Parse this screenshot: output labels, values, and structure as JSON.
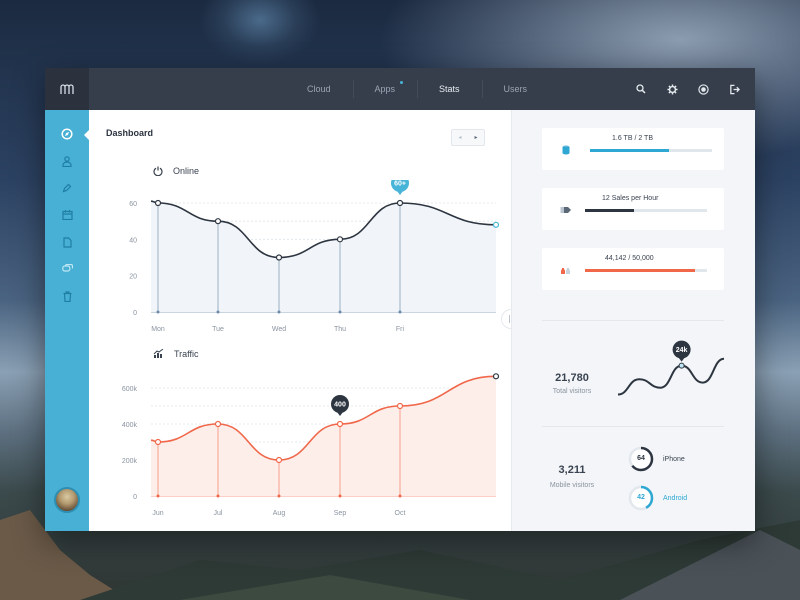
{
  "topbar": {
    "logo_icon": "m-logo-icon",
    "nav": [
      {
        "label": "Cloud",
        "active": false,
        "badge": false
      },
      {
        "label": "Apps",
        "active": false,
        "badge": true
      },
      {
        "label": "Stats",
        "active": true,
        "badge": false
      },
      {
        "label": "Users",
        "active": false,
        "badge": false
      }
    ],
    "tools": [
      "search-icon",
      "gear-icon",
      "globe-icon",
      "logout-icon"
    ]
  },
  "sidebar": {
    "items": [
      {
        "icon": "compass-icon",
        "active": true
      },
      {
        "icon": "user-icon",
        "active": false
      },
      {
        "icon": "pen-icon",
        "active": false
      },
      {
        "icon": "calendar-icon",
        "active": false
      },
      {
        "icon": "file-icon",
        "active": false
      },
      {
        "icon": "chat-icon",
        "active": false
      },
      {
        "icon": "trash-icon",
        "active": false
      }
    ],
    "avatar": "user-avatar"
  },
  "main": {
    "title": "Dashboard",
    "pager": {
      "prev": "◂",
      "next": "▸"
    }
  },
  "chart_data": [
    {
      "type": "line",
      "title": "Online",
      "icon": "power-icon",
      "categories": [
        "Mon",
        "Tue",
        "Wed",
        "Thu",
        "Fri"
      ],
      "values": [
        60,
        50,
        30,
        40,
        60
      ],
      "trailing_value": 48,
      "leading_value": 61,
      "ylim": [
        0,
        60
      ],
      "yticks": [
        "0",
        "20",
        "40",
        "60"
      ],
      "grid": true,
      "highlight": {
        "index": 4,
        "label": "60+"
      },
      "line_color": "#2d3541",
      "fill_color": "#f1f4f8",
      "accent_color": "#47b4d8"
    },
    {
      "type": "area",
      "title": "Traffic",
      "icon": "chart-icon",
      "categories": [
        "Jun",
        "Jul",
        "Aug",
        "Sep",
        "Oct"
      ],
      "values": [
        300,
        400,
        200,
        400,
        500
      ],
      "trailing_value": 665,
      "leading_value": 310,
      "ylim": [
        0,
        600
      ],
      "yticks": [
        "0",
        "200k",
        "400k",
        "600k"
      ],
      "grid": true,
      "highlight": {
        "index": 3,
        "label": "400"
      },
      "line_color": "#f0674a",
      "fill_color": "#fdeeea",
      "accent_color": "#2d3541"
    }
  ],
  "right": {
    "cards": [
      {
        "icon": "database-icon",
        "label": "1.6 TB / 2 TB",
        "progress": 0.65,
        "color": "#2ea8d3"
      },
      {
        "icon": "tag-icon",
        "label": "12 Sales per Hour",
        "progress": 0.4,
        "color": "#2d3541"
      },
      {
        "icon": "users-icon",
        "label": "44,142 / 50,000",
        "progress": 0.9,
        "color": "#f0674a"
      }
    ],
    "visitors": {
      "value": "21,780",
      "label": "Total visitors",
      "peak_label": "24k",
      "sparkline": [
        5,
        14,
        9,
        22,
        12,
        26
      ]
    },
    "mobile": {
      "value": "3,211",
      "label": "Mobile visitors",
      "devices": [
        {
          "name": "iPhone",
          "value": "64",
          "percent": 0.64,
          "color": "#2d3541"
        },
        {
          "name": "Android",
          "value": "42",
          "percent": 0.42,
          "color": "#2ea8d3"
        }
      ]
    }
  }
}
